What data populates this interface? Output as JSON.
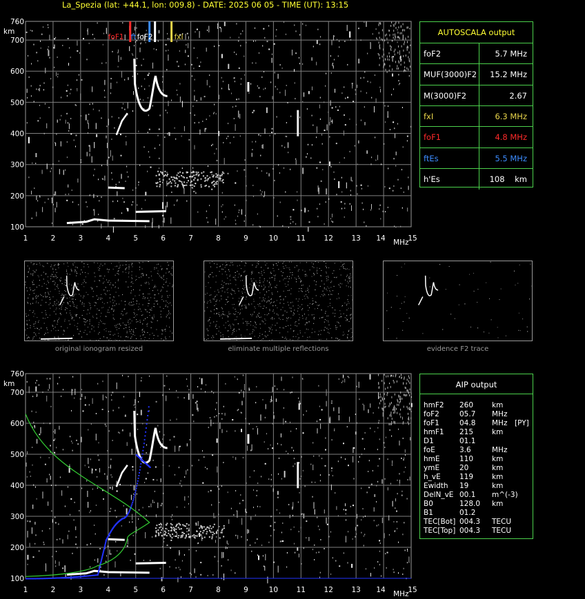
{
  "header": {
    "title": "La_Spezia (lat: +44.1, lon: 009.8) - DATE: 2025 06 05 - TIME (UT): 13:15"
  },
  "colors": {
    "background": "#000000",
    "grid": "#9a9a9a",
    "panel_border": "#4cd24c",
    "title": "#ffff33",
    "foF1_red": "#ff2a2a",
    "ftEs_blue": "#3c8cff",
    "fxI_yellow": "#e8d44a",
    "profile_green": "#33cc33",
    "aip_blue": "#2233ff"
  },
  "top_ionogram": {
    "y_unit": "km",
    "x_unit": "MHz",
    "y_ticks": [
      "760",
      "700",
      "600",
      "500",
      "400",
      "300",
      "200",
      "100"
    ],
    "x_ticks": [
      "1",
      "2",
      "3",
      "4",
      "5",
      "6",
      "7",
      "8",
      "9",
      "10",
      "11",
      "12",
      "13",
      "14",
      "15"
    ],
    "markers": [
      {
        "label": "foF1",
        "freq": 4.8,
        "color": "#ff2a2a"
      },
      {
        "label": "ft",
        "freq": 5.5,
        "color": "#3c8cff"
      },
      {
        "label": "foF2",
        "freq": 5.7,
        "color": "#ffffff"
      },
      {
        "label": "fxI",
        "freq": 6.3,
        "color": "#e8d44a"
      }
    ]
  },
  "autoscala": {
    "title": "AUTOSCALA output",
    "rows": [
      {
        "label": "foF2",
        "value": "5.7 MHz",
        "color": "#ffffff"
      },
      {
        "label": "MUF(3000)F2",
        "value": "15.2 MHz",
        "color": "#ffffff"
      },
      {
        "label": "M(3000)F2",
        "value": "2.67",
        "color": "#ffffff"
      },
      {
        "label": "fxI",
        "value": "6.3 MHz",
        "color": "#e8d44a"
      },
      {
        "label": "foF1",
        "value": "4.8 MHz",
        "color": "#ff2a2a"
      },
      {
        "label": "ftEs",
        "value": "5.5 MHz",
        "color": "#3c8cff"
      },
      {
        "label": "h'Es",
        "value": "108    km",
        "color": "#ffffff"
      }
    ]
  },
  "thumbnails": [
    {
      "caption": "original ionogram resized"
    },
    {
      "caption": "eliminate multiple reflections"
    },
    {
      "caption": "evidence F2 trace"
    }
  ],
  "bottom_ionogram": {
    "y_unit": "km",
    "x_unit": "MHz",
    "y_ticks": [
      "760",
      "700",
      "600",
      "500",
      "400",
      "300",
      "200",
      "100"
    ],
    "x_ticks": [
      "1",
      "2",
      "3",
      "4",
      "5",
      "6",
      "7",
      "8",
      "9",
      "10",
      "11",
      "12",
      "13",
      "14",
      "15"
    ]
  },
  "aip": {
    "title": "AIP output",
    "rows": [
      {
        "name": "hmF2",
        "value": "260",
        "unit": "km",
        "extra": ""
      },
      {
        "name": "foF2",
        "value": "05.7",
        "unit": "MHz",
        "extra": ""
      },
      {
        "name": "foF1",
        "value": "04.8",
        "unit": "MHz",
        "extra": "[PY]"
      },
      {
        "name": "hmF1",
        "value": "215",
        "unit": "km",
        "extra": ""
      },
      {
        "name": "D1",
        "value": "01.1",
        "unit": "",
        "extra": ""
      },
      {
        "name": "foE",
        "value": "3.6",
        "unit": "MHz",
        "extra": ""
      },
      {
        "name": "hmE",
        "value": "110",
        "unit": "km",
        "extra": ""
      },
      {
        "name": "ymE",
        "value": "20",
        "unit": "km",
        "extra": ""
      },
      {
        "name": "h_vE",
        "value": "119",
        "unit": "km",
        "extra": ""
      },
      {
        "name": "Ewidth",
        "value": "19",
        "unit": "km",
        "extra": ""
      },
      {
        "name": "DelN_vE",
        "value": "00.1",
        "unit": "m^(-3)",
        "extra": ""
      },
      {
        "name": "B0",
        "value": "128.0",
        "unit": "km",
        "extra": ""
      },
      {
        "name": "B1",
        "value": "01.2",
        "unit": "",
        "extra": ""
      },
      {
        "name": "TEC[Bot]",
        "value": "004.3",
        "unit": "TECU",
        "extra": ""
      },
      {
        "name": "TEC[Top]",
        "value": "004.3",
        "unit": "TECU",
        "extra": ""
      }
    ]
  }
}
